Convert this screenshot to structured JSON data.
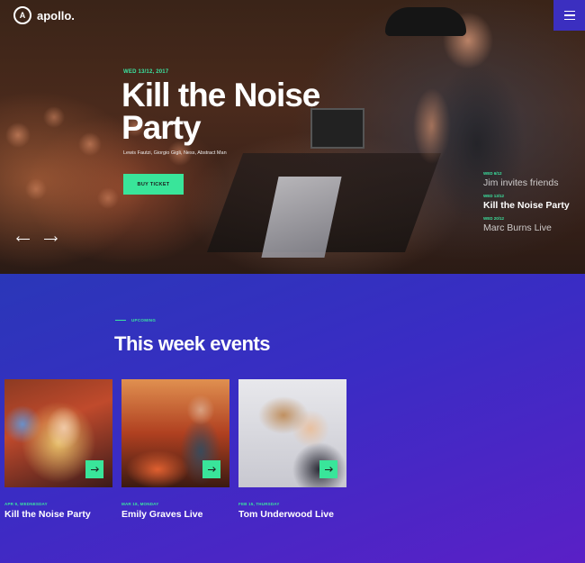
{
  "header": {
    "logo_mark": "A",
    "logo_text": "apollo.",
    "menu_icon": "hamburger-icon"
  },
  "hero": {
    "date": "WED 13/12, 2017",
    "title": "Kill the Noise Party",
    "artists": "Lewis Fautzi, Giorgio Gigli, Ness, Abstract Man",
    "buy_label": "BUY TICKET",
    "prev_icon": "arrow-left-icon",
    "next_icon": "arrow-right-icon"
  },
  "side_events": [
    {
      "date": "WED 6/12",
      "name": "Jim invites friends"
    },
    {
      "date": "WED 13/12",
      "name": "Kill the Noise Party"
    },
    {
      "date": "WED 20/12",
      "name": "Marc Burns Live"
    }
  ],
  "events": {
    "eyebrow": "UPCOMING",
    "title": "This week events",
    "cards": [
      {
        "date": "APR 9, WEDNESDAY",
        "title": "Kill the Noise Party"
      },
      {
        "date": "MAR 18, MONDAY",
        "title": "Emily Graves Live"
      },
      {
        "date": "FEB 15, THURSDAY",
        "title": "Tom Underwood Live"
      }
    ]
  },
  "colors": {
    "accent": "#39e59a",
    "menu_bg": "#3b2fc0",
    "events_gradient_start": "#2a37b8",
    "events_gradient_end": "#5a20c6"
  }
}
